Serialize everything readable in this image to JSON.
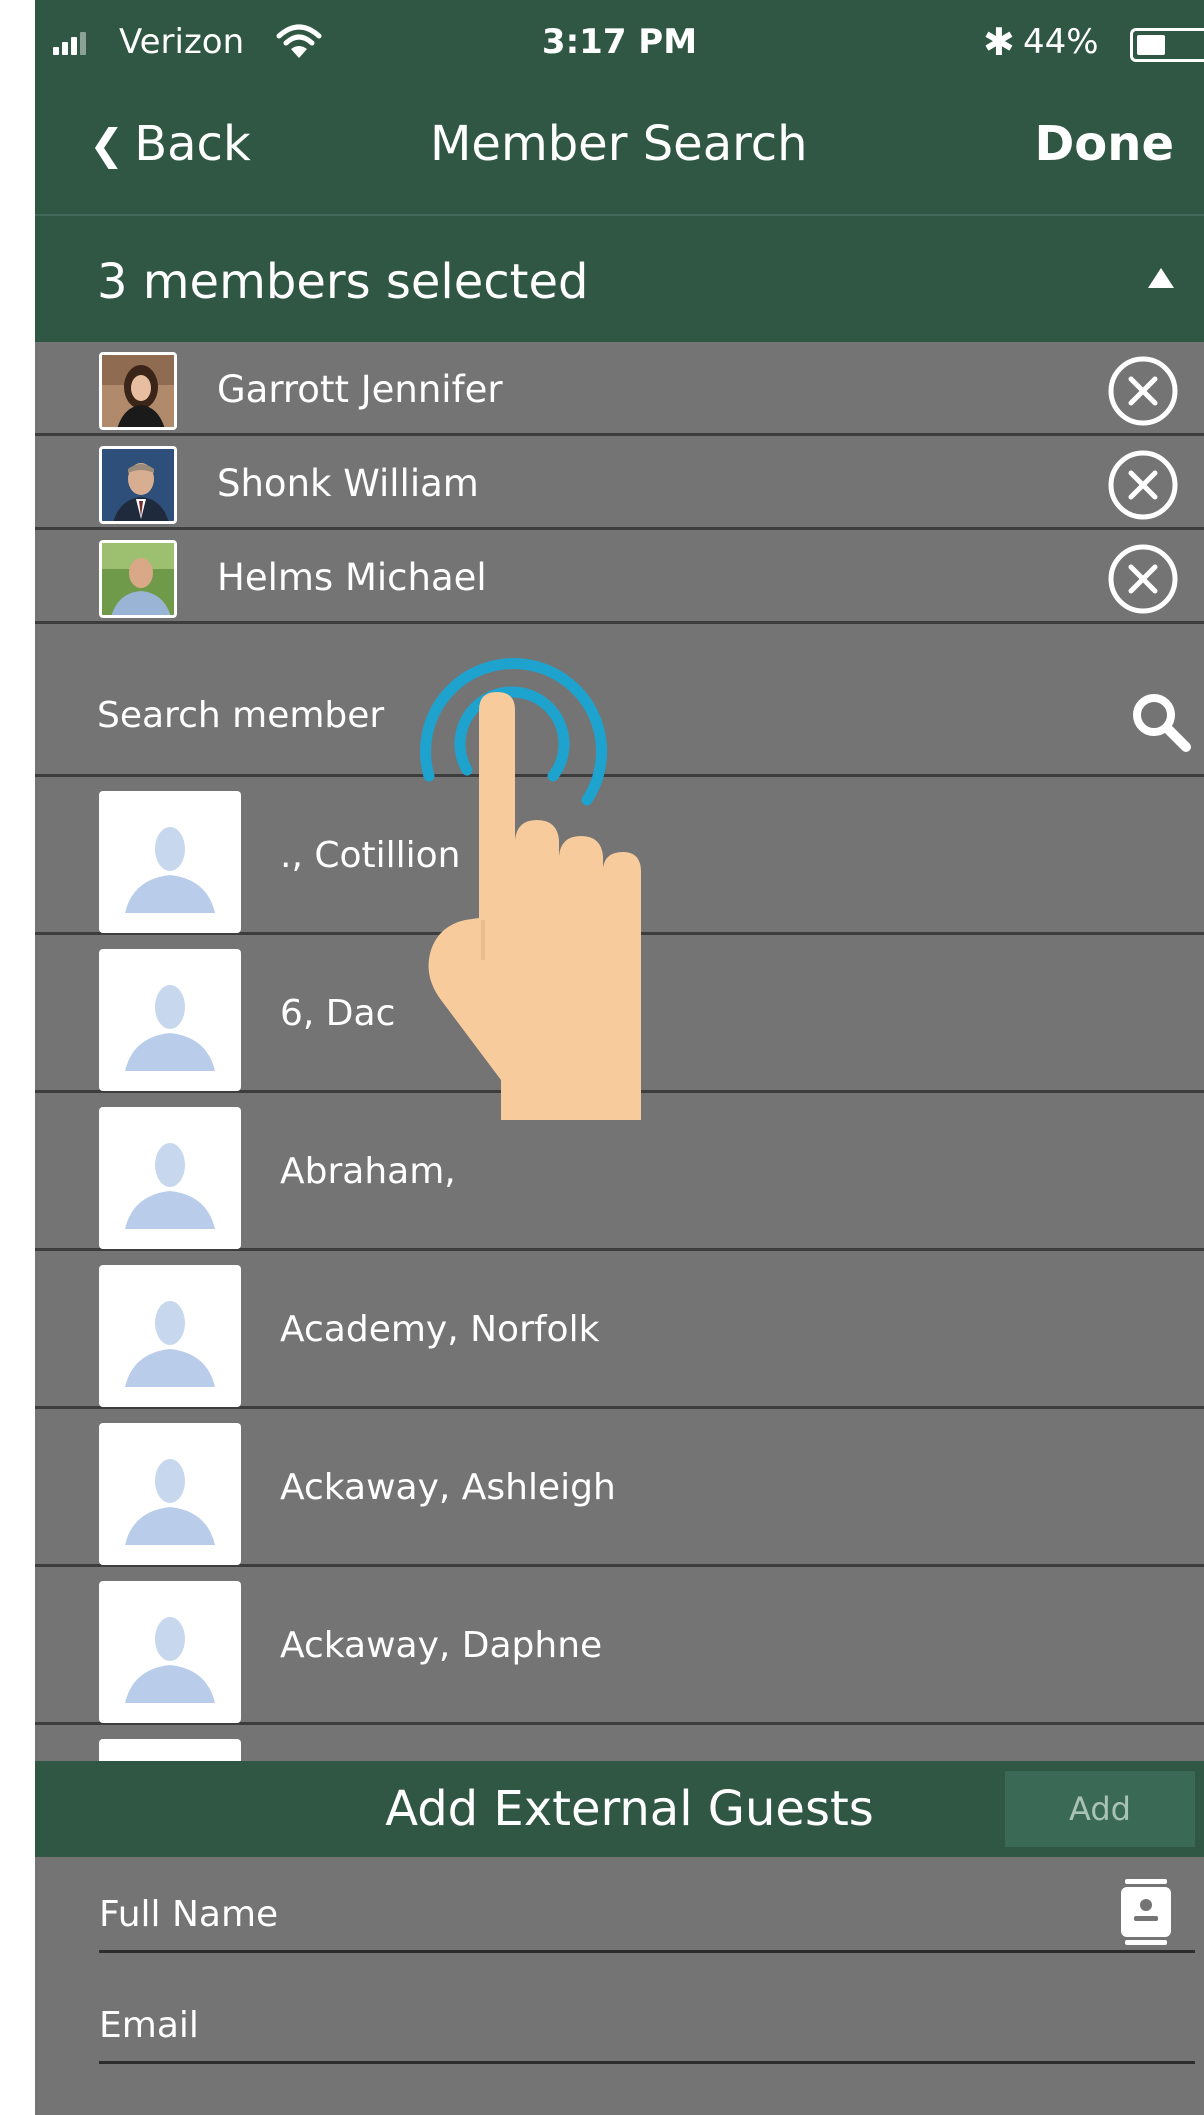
{
  "status_bar": {
    "carrier": "Verizon",
    "time": "3:17 PM",
    "battery": "44%",
    "icons": [
      "signal-icon",
      "wifi-icon",
      "bluetooth-icon",
      "battery-icon"
    ]
  },
  "nav": {
    "back_label": "Back",
    "title": "Member Search",
    "done_label": "Done"
  },
  "selection": {
    "header": "3 members selected",
    "members": [
      {
        "name": "Garrott Jennifer"
      },
      {
        "name": "Shonk William"
      },
      {
        "name": "Helms Michael"
      }
    ]
  },
  "search": {
    "placeholder": "Search member"
  },
  "members": [
    {
      "name": "., Cotillion"
    },
    {
      "name": "6, Dac"
    },
    {
      "name": "Abraham,"
    },
    {
      "name": "Academy, Norfolk"
    },
    {
      "name": "Ackaway, Ashleigh"
    },
    {
      "name": "Ackaway, Daphne"
    },
    {
      "name": ""
    }
  ],
  "external_guests": {
    "header": "Add External Guests",
    "add_label": "Add",
    "full_name_placeholder": "Full Name",
    "email_placeholder": "Email"
  },
  "colors": {
    "header_green": "#2f5744",
    "list_gray": "#747474",
    "tap_blue": "#1ea3cf",
    "hand_skin": "#f8cb9c"
  }
}
